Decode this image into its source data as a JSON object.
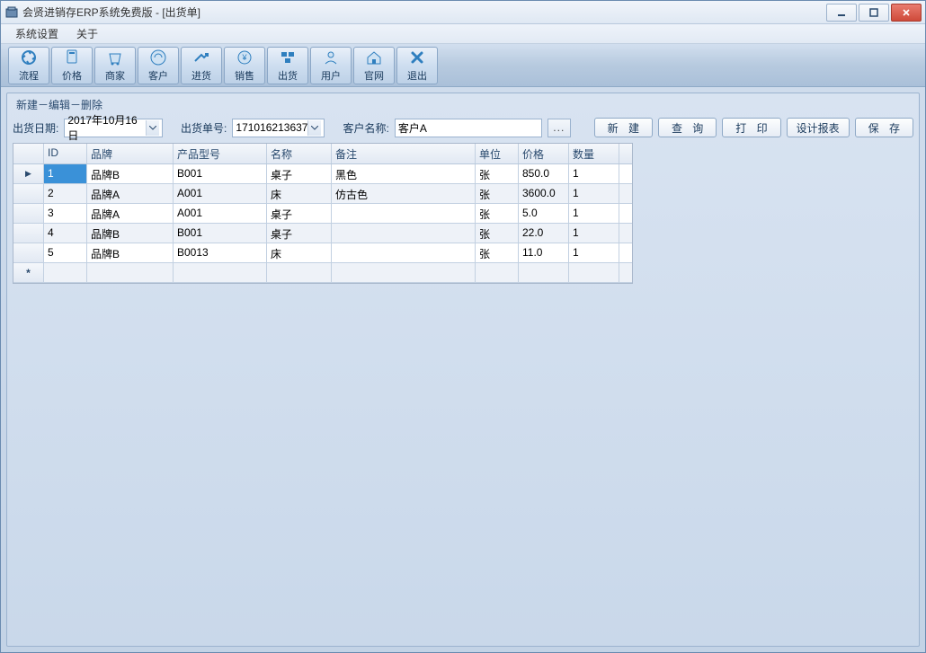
{
  "window": {
    "title": "会贤进销存ERP系统免费版 - [出货单]"
  },
  "menu": {
    "settings": "系统设置",
    "about": "关于"
  },
  "toolbar": {
    "flow": "流程",
    "price": "价格",
    "merchant": "商家",
    "customer": "客户",
    "purchase": "进货",
    "sales": "销售",
    "shipment": "出货",
    "user": "用户",
    "website": "官网",
    "exit": "退出"
  },
  "panel": {
    "legend": "新建－编辑－删除",
    "ship_date_label": "出货日期:",
    "ship_date_value": "2017年10月16日",
    "ship_no_label": "出货单号:",
    "ship_no_value": "171016213637",
    "customer_label": "客户名称:",
    "customer_value": "客户A"
  },
  "actions": {
    "new": "新 建",
    "query": "查 询",
    "print": "打 印",
    "design": "设计报表",
    "save": "保 存"
  },
  "grid": {
    "headers": {
      "id": "ID",
      "brand": "品牌",
      "model": "产品型号",
      "name": "名称",
      "remark": "备注",
      "unit": "单位",
      "price": "价格",
      "qty": "数量"
    },
    "rows": [
      {
        "id": "1",
        "brand": "品牌B",
        "model": "B001",
        "name": "桌子",
        "remark": "黑色",
        "unit": "张",
        "price": "850.0",
        "qty": "1"
      },
      {
        "id": "2",
        "brand": "品牌A",
        "model": "A001",
        "name": "床",
        "remark": "仿古色",
        "unit": "张",
        "price": "3600.0",
        "qty": "1"
      },
      {
        "id": "3",
        "brand": "品牌A",
        "model": "A001",
        "name": "桌子",
        "remark": "",
        "unit": "张",
        "price": "5.0",
        "qty": "1"
      },
      {
        "id": "4",
        "brand": "品牌B",
        "model": "B001",
        "name": "桌子",
        "remark": "",
        "unit": "张",
        "price": "22.0",
        "qty": "1"
      },
      {
        "id": "5",
        "brand": "品牌B",
        "model": "B0013",
        "name": "床",
        "remark": "",
        "unit": "张",
        "price": "11.0",
        "qty": "1"
      }
    ]
  }
}
